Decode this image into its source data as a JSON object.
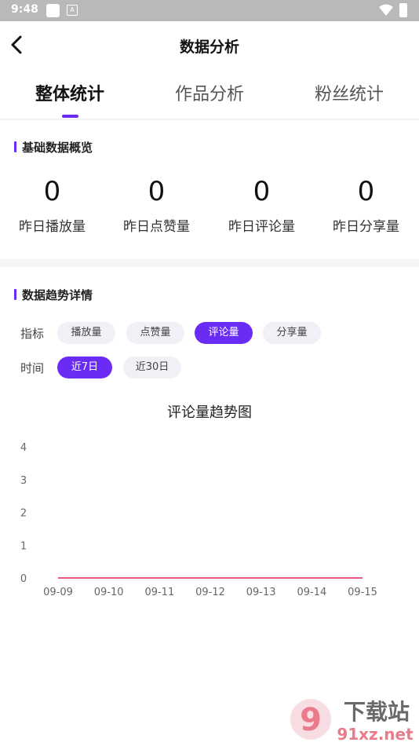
{
  "status_bar": {
    "time": "9:48",
    "icon_label": "A"
  },
  "nav": {
    "title": "数据分析"
  },
  "tabs": [
    {
      "label": "整体统计",
      "active": true
    },
    {
      "label": "作品分析",
      "active": false
    },
    {
      "label": "粉丝统计",
      "active": false
    }
  ],
  "overview": {
    "title": "基础数据概览",
    "stats": [
      {
        "value": "0",
        "label": "昨日播放量"
      },
      {
        "value": "0",
        "label": "昨日点赞量"
      },
      {
        "value": "0",
        "label": "昨日评论量"
      },
      {
        "value": "0",
        "label": "昨日分享量"
      }
    ]
  },
  "trend": {
    "title": "数据趋势详情",
    "metric_label": "指标",
    "metrics": [
      {
        "label": "播放量",
        "active": false
      },
      {
        "label": "点赞量",
        "active": false
      },
      {
        "label": "评论量",
        "active": true
      },
      {
        "label": "分享量",
        "active": false
      }
    ],
    "time_label": "时间",
    "ranges": [
      {
        "label": "近7日",
        "active": true
      },
      {
        "label": "近30日",
        "active": false
      }
    ]
  },
  "chart_data": {
    "type": "line",
    "title": "评论量趋势图",
    "categories": [
      "09-09",
      "09-10",
      "09-11",
      "09-12",
      "09-13",
      "09-14",
      "09-15"
    ],
    "values": [
      0,
      0,
      0,
      0,
      0,
      0,
      0
    ],
    "y_ticks": [
      "0",
      "1",
      "2",
      "3",
      "4"
    ],
    "ylim": [
      0,
      4
    ],
    "line_color": "#e85a7c",
    "grid": false
  },
  "watermark": {
    "text_top": "下载站",
    "text_bottom": "91xz.net"
  },
  "colors": {
    "accent": "#6a2cf5",
    "chip_bg": "#f1f0f6"
  }
}
